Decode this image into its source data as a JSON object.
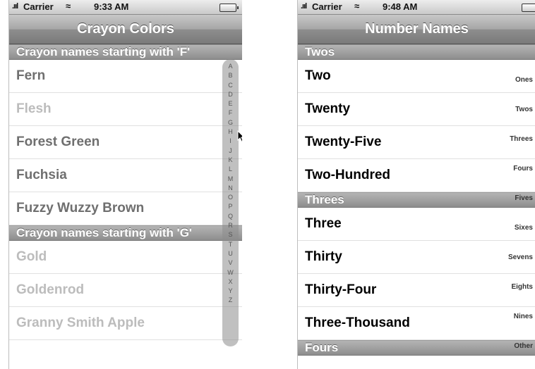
{
  "left_phone": {
    "status": {
      "carrier": "Carrier",
      "time": "9:33 AM"
    },
    "nav_title": "Crayon Colors",
    "sections": [
      {
        "header": "Crayon names starting with 'F'",
        "items": [
          "Fern",
          "Flesh",
          "Forest Green",
          "Fuchsia",
          "Fuzzy Wuzzy Brown"
        ]
      },
      {
        "header": "Crayon names starting with 'G'",
        "items": [
          "Gold",
          "Goldenrod",
          "Granny Smith Apple"
        ]
      }
    ],
    "index_letters": [
      "A",
      "B",
      "C",
      "D",
      "E",
      "F",
      "G",
      "H",
      "I",
      "J",
      "K",
      "L",
      "M",
      "N",
      "O",
      "P",
      "Q",
      "R",
      "S",
      "T",
      "U",
      "V",
      "W",
      "X",
      "Y",
      "Z"
    ]
  },
  "right_phone": {
    "status": {
      "carrier": "Carrier",
      "time": "9:48 AM"
    },
    "nav_title": "Number Names",
    "sections": [
      {
        "header": "Twos",
        "items": [
          "Two",
          "Twenty",
          "Twenty-Five",
          "Two-Hundred"
        ]
      },
      {
        "header": "Threes",
        "items": [
          "Three",
          "Thirty",
          "Thirty-Four",
          "Three-Thousand"
        ]
      },
      {
        "header": "Fours",
        "items": []
      }
    ],
    "index_titles": [
      "Ones",
      "Twos",
      "Threes",
      "Fours",
      "Fives",
      "Sixes",
      "Sevens",
      "Eights",
      "Nines",
      "Other"
    ]
  },
  "colors": {
    "nav_text": "#ffffff",
    "section_bg": "#9f9f9f"
  }
}
